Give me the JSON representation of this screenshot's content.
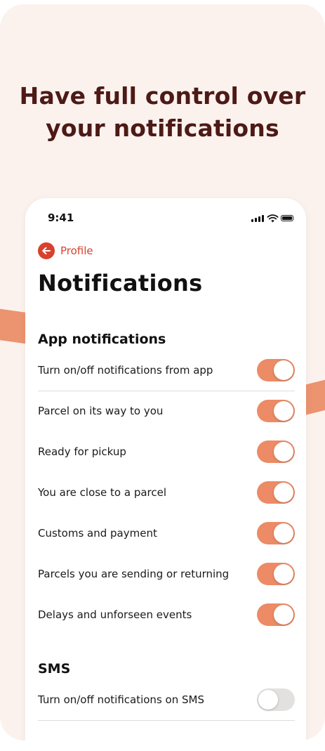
{
  "headline": {
    "line1": "Have full control over",
    "line2": "your notifications"
  },
  "status_bar": {
    "time": "9:41",
    "icons": [
      "signal-icon",
      "wifi-icon",
      "battery-icon"
    ]
  },
  "nav": {
    "back_label": "Profile",
    "back_icon": "arrow-left-icon"
  },
  "page_title": "Notifications",
  "app_section": {
    "heading": "App notifications",
    "master": {
      "label": "Turn on/off notifications from app",
      "on": true
    },
    "items": [
      {
        "label": "Parcel on its way to you",
        "on": true
      },
      {
        "label": "Ready for pickup",
        "on": true
      },
      {
        "label": "You are close to a parcel",
        "on": true
      },
      {
        "label": "Customs and payment",
        "on": true
      },
      {
        "label": "Parcels you are sending or returning",
        "on": true
      },
      {
        "label": "Delays and unforseen events",
        "on": true
      }
    ]
  },
  "sms_section": {
    "heading": "SMS",
    "master": {
      "label": "Turn on/off notifications on SMS",
      "on": false
    }
  },
  "colors": {
    "accent": "#ec8b65",
    "brand_red": "#d8412e",
    "headline": "#4d1a16",
    "background": "#fbf2ee",
    "toggle_off": "#e3e1e0"
  }
}
